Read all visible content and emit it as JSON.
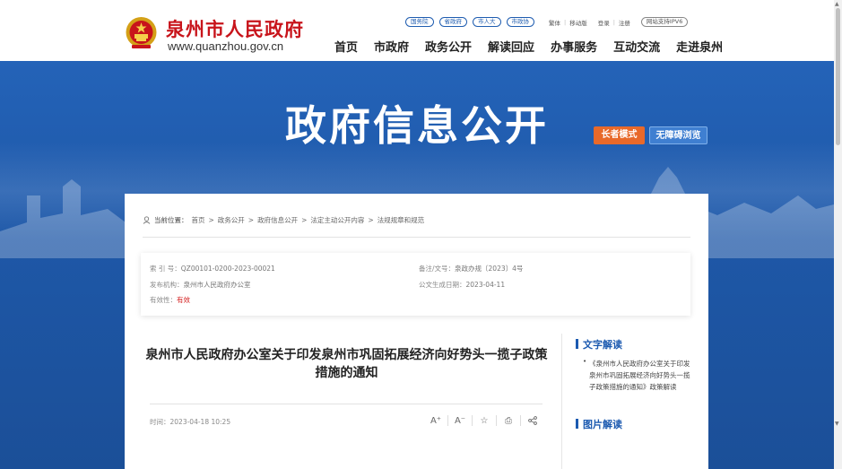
{
  "header": {
    "site_name": "泉州市人民政府",
    "site_url": "www.quanzhou.gov.cn",
    "top_links": [
      "国务院",
      "省政府",
      "市人大",
      "市政协"
    ],
    "utilities": [
      "繁体",
      "|",
      "移动版",
      "登录",
      "|",
      "注册"
    ],
    "ipv6_badge": "网站支持IPV6",
    "nav": [
      "首页",
      "市政府",
      "政务公开",
      "解读回应",
      "办事服务",
      "互动交流",
      "走进泉州"
    ]
  },
  "banner": {
    "title": "政府信息公开",
    "elder_mode": "长者模式",
    "accessible": "无障碍浏览"
  },
  "breadcrumb": {
    "label": "当前位置：",
    "items": [
      "首页",
      ">",
      "政务公开",
      ">",
      "政府信息公开",
      ">",
      "法定主动公开内容",
      ">",
      "法规规章和规范"
    ]
  },
  "meta": {
    "index_label": "索 引 号：",
    "index_value": "QZ00101-0200-2023-00021",
    "record_label": "备注/文号：",
    "record_value": "泉政办规〔2023〕4号",
    "publisher_label": "发布机构：",
    "publisher_value": "泉州市人民政府办公室",
    "generated_label": "公文生成日期：",
    "generated_value": "2023-04-11",
    "validity_label": "有效性：",
    "validity_value": "有效"
  },
  "article": {
    "title": "泉州市人民政府办公室关于印发泉州市巩固拓展经济向好势头一揽子政策措施的通知",
    "time_label": "时间：",
    "time_value": "2023-04-18 10:25",
    "tools": [
      "A⁺",
      "A⁻",
      "☆",
      "⎙",
      "share-icon"
    ]
  },
  "sidebar": {
    "text_interp_heading": "文字解读",
    "text_interp_bullet": "•",
    "text_interp_item": "《泉州市人民政府办公室关于印发泉州市巩固拓展经济向好势头一揽子政策措施的通知》政策解读",
    "image_interp_heading": "图片解读"
  },
  "colors": {
    "brand_red": "#c8141b",
    "banner_blue": "#1e58a8",
    "elder_orange": "#e8692a",
    "accent_blue": "#1c5ab0"
  }
}
